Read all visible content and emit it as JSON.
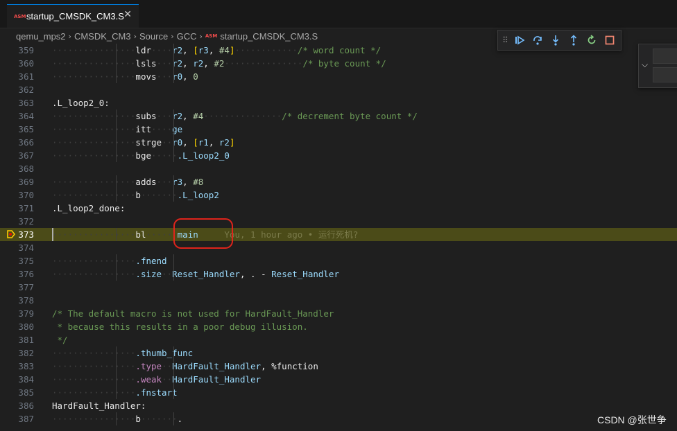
{
  "tab": {
    "icon_text": "ASM",
    "title": "startup_CMSDK_CM3.S",
    "close_icon": "✕"
  },
  "breadcrumb": {
    "items": [
      "qemu_mps2",
      "CMSDK_CM3",
      "Source",
      "GCC"
    ],
    "file_icon": "ASM",
    "file": "startup_CMSDK_CM3.S"
  },
  "debug_toolbar": {
    "buttons": [
      "continue",
      "step-over",
      "step-into",
      "step-out",
      "restart",
      "stop"
    ],
    "colors": {
      "blue": "#75beff",
      "green": "#89d185",
      "red": "#f48771"
    }
  },
  "blame": "You, 1 hour ago • 运行死机?",
  "watermark": "CSDN @张世争",
  "lines": [
    {
      "n": "359",
      "indent": 2,
      "t": [
        [
          "kw",
          "ldr"
        ],
        [
          "ws",
          "····"
        ],
        [
          "reg",
          "r2"
        ],
        [
          "kw",
          ", "
        ],
        [
          "br",
          "["
        ],
        [
          "reg",
          "r3"
        ],
        [
          "kw",
          ", "
        ],
        [
          "num",
          "#4"
        ],
        [
          "br",
          "]"
        ],
        [
          "ws",
          "············"
        ],
        [
          "cm",
          "/* word count */"
        ]
      ]
    },
    {
      "n": "360",
      "indent": 2,
      "t": [
        [
          "kw",
          "lsls"
        ],
        [
          "ws",
          "···"
        ],
        [
          "reg",
          "r2"
        ],
        [
          "kw",
          ", "
        ],
        [
          "reg",
          "r2"
        ],
        [
          "kw",
          ", "
        ],
        [
          "num",
          "#2"
        ],
        [
          "ws",
          "···············"
        ],
        [
          "cm",
          "/* byte count */"
        ]
      ]
    },
    {
      "n": "361",
      "indent": 2,
      "t": [
        [
          "kw",
          "movs"
        ],
        [
          "ws",
          "···"
        ],
        [
          "reg",
          "r0"
        ],
        [
          "kw",
          ", "
        ],
        [
          "num",
          "0"
        ]
      ]
    },
    {
      "n": "362",
      "indent": 0,
      "t": []
    },
    {
      "n": "363",
      "indent": 0,
      "t": [
        [
          "lbl",
          ".L_loop2_0:"
        ]
      ]
    },
    {
      "n": "364",
      "indent": 2,
      "t": [
        [
          "kw",
          "subs"
        ],
        [
          "ws",
          "···"
        ],
        [
          "reg",
          "r2"
        ],
        [
          "kw",
          ", "
        ],
        [
          "num",
          "#4"
        ],
        [
          "ws",
          "···············"
        ],
        [
          "cm",
          "/* decrement byte count */"
        ]
      ]
    },
    {
      "n": "365",
      "indent": 2,
      "t": [
        [
          "kw",
          "itt"
        ],
        [
          "ws",
          "····"
        ],
        [
          "reg",
          "ge"
        ]
      ]
    },
    {
      "n": "366",
      "indent": 2,
      "t": [
        [
          "kw",
          "strge"
        ],
        [
          "ws",
          "··"
        ],
        [
          "reg",
          "r0"
        ],
        [
          "kw",
          ", "
        ],
        [
          "br",
          "["
        ],
        [
          "reg",
          "r1"
        ],
        [
          "kw",
          ", "
        ],
        [
          "reg",
          "r2"
        ],
        [
          "br",
          "]"
        ]
      ]
    },
    {
      "n": "367",
      "indent": 2,
      "t": [
        [
          "kw",
          "bge"
        ],
        [
          "ws",
          "·····"
        ],
        [
          "sym",
          ".L_loop2_0"
        ]
      ]
    },
    {
      "n": "368",
      "indent": 0,
      "t": []
    },
    {
      "n": "369",
      "indent": 2,
      "t": [
        [
          "kw",
          "adds"
        ],
        [
          "ws",
          "···"
        ],
        [
          "reg",
          "r3"
        ],
        [
          "kw",
          ", "
        ],
        [
          "num",
          "#8"
        ]
      ]
    },
    {
      "n": "370",
      "indent": 2,
      "t": [
        [
          "kw",
          "b"
        ],
        [
          "ws",
          "·······"
        ],
        [
          "sym",
          ".L_loop2"
        ]
      ]
    },
    {
      "n": "371",
      "indent": 0,
      "t": [
        [
          "lbl",
          ".L_loop2_done:"
        ]
      ]
    },
    {
      "n": "372",
      "indent": 0,
      "t": []
    },
    {
      "n": "373",
      "indent": 2,
      "hl": true,
      "t": [
        [
          "kw",
          "bl"
        ],
        [
          "ws",
          "······"
        ],
        [
          "sym",
          "main"
        ],
        [
          "ws",
          "     "
        ],
        [
          "blame",
          "@blame"
        ]
      ]
    },
    {
      "n": "374",
      "indent": 0,
      "t": []
    },
    {
      "n": "375",
      "indent": 2,
      "t": [
        [
          "dir",
          ".fnend"
        ]
      ]
    },
    {
      "n": "376",
      "indent": 2,
      "t": [
        [
          "dir",
          ".size"
        ],
        [
          "ws",
          "··"
        ],
        [
          "sym",
          "Reset_Handler"
        ],
        [
          "kw",
          ", "
        ],
        [
          "kw",
          "."
        ],
        [
          "kw",
          " - "
        ],
        [
          "sym",
          "Reset_Handler"
        ]
      ]
    },
    {
      "n": "377",
      "indent": 0,
      "t": []
    },
    {
      "n": "378",
      "indent": 0,
      "t": []
    },
    {
      "n": "379",
      "indent": 0,
      "t": [
        [
          "cm",
          "/* The default macro is not used for HardFault_Handler"
        ]
      ]
    },
    {
      "n": "380",
      "indent": 0,
      "t": [
        [
          "cm",
          " * because this results in a poor debug illusion."
        ]
      ]
    },
    {
      "n": "381",
      "indent": 0,
      "t": [
        [
          "cm",
          " */"
        ]
      ]
    },
    {
      "n": "382",
      "indent": 2,
      "t": [
        [
          "dir",
          ".thumb_func"
        ]
      ]
    },
    {
      "n": "383",
      "indent": 2,
      "t": [
        [
          "pk",
          ".type"
        ],
        [
          "ws",
          "··"
        ],
        [
          "sym",
          "HardFault_Handler"
        ],
        [
          "kw",
          ", "
        ],
        [
          "kw",
          "%function"
        ]
      ]
    },
    {
      "n": "384",
      "indent": 2,
      "t": [
        [
          "pk",
          ".weak"
        ],
        [
          "ws",
          "··"
        ],
        [
          "sym",
          "HardFault_Handler"
        ]
      ]
    },
    {
      "n": "385",
      "indent": 2,
      "t": [
        [
          "dir",
          ".fnstart"
        ]
      ]
    },
    {
      "n": "386",
      "indent": 0,
      "t": [
        [
          "lbl",
          "HardFault_Handler:"
        ]
      ]
    },
    {
      "n": "387",
      "indent": 2,
      "t": [
        [
          "kw",
          "b"
        ],
        [
          "ws",
          "·······"
        ],
        [
          "kw",
          "."
        ]
      ]
    }
  ]
}
